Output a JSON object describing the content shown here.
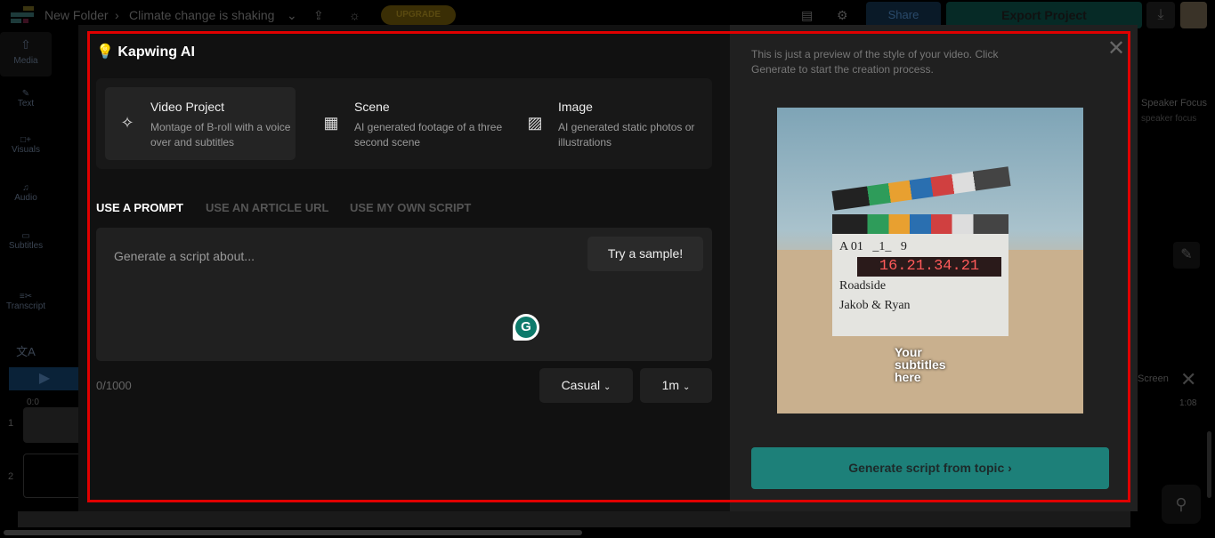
{
  "topbar": {
    "folder": "New Folder",
    "project": "Climate change is shaking",
    "upgrade": "UPGRADE",
    "share": "Share",
    "export": "Export Project"
  },
  "sidebar": [
    "Media",
    "Text",
    "Visuals",
    "Audio",
    "Subtitles",
    "Transcript"
  ],
  "background": {
    "right_title": "Speaker Focus",
    "right_sub": "speaker focus",
    "fullscreen": "Screen",
    "time_start": "0:0",
    "time_end": "1:08",
    "tracks": [
      "1",
      "2"
    ]
  },
  "modal": {
    "brand": "Kapwing AI",
    "cards": [
      {
        "title": "Video Project",
        "desc": "Montage of B-roll with a voice over and subtitles",
        "icon": "magic-wand-icon"
      },
      {
        "title": "Scene",
        "desc": "AI generated footage of a three second scene",
        "icon": "film-icon"
      },
      {
        "title": "Image",
        "desc": "AI generated static photos or illustrations",
        "icon": "image-icon"
      }
    ],
    "tabs": [
      "USE A PROMPT",
      "USE AN ARTICLE URL",
      "USE MY OWN SCRIPT"
    ],
    "prompt_placeholder": "Generate a script about...",
    "sample_button": "Try a sample!",
    "char_count": "0/1000",
    "tone": "Casual",
    "duration": "1m",
    "preview_note": "This is just a preview of the style of your video. Click Generate to start the creation process.",
    "preview_subtitle": "Your subtitles here",
    "generate_button": "Generate script from topic",
    "accent": "#1d8079"
  }
}
